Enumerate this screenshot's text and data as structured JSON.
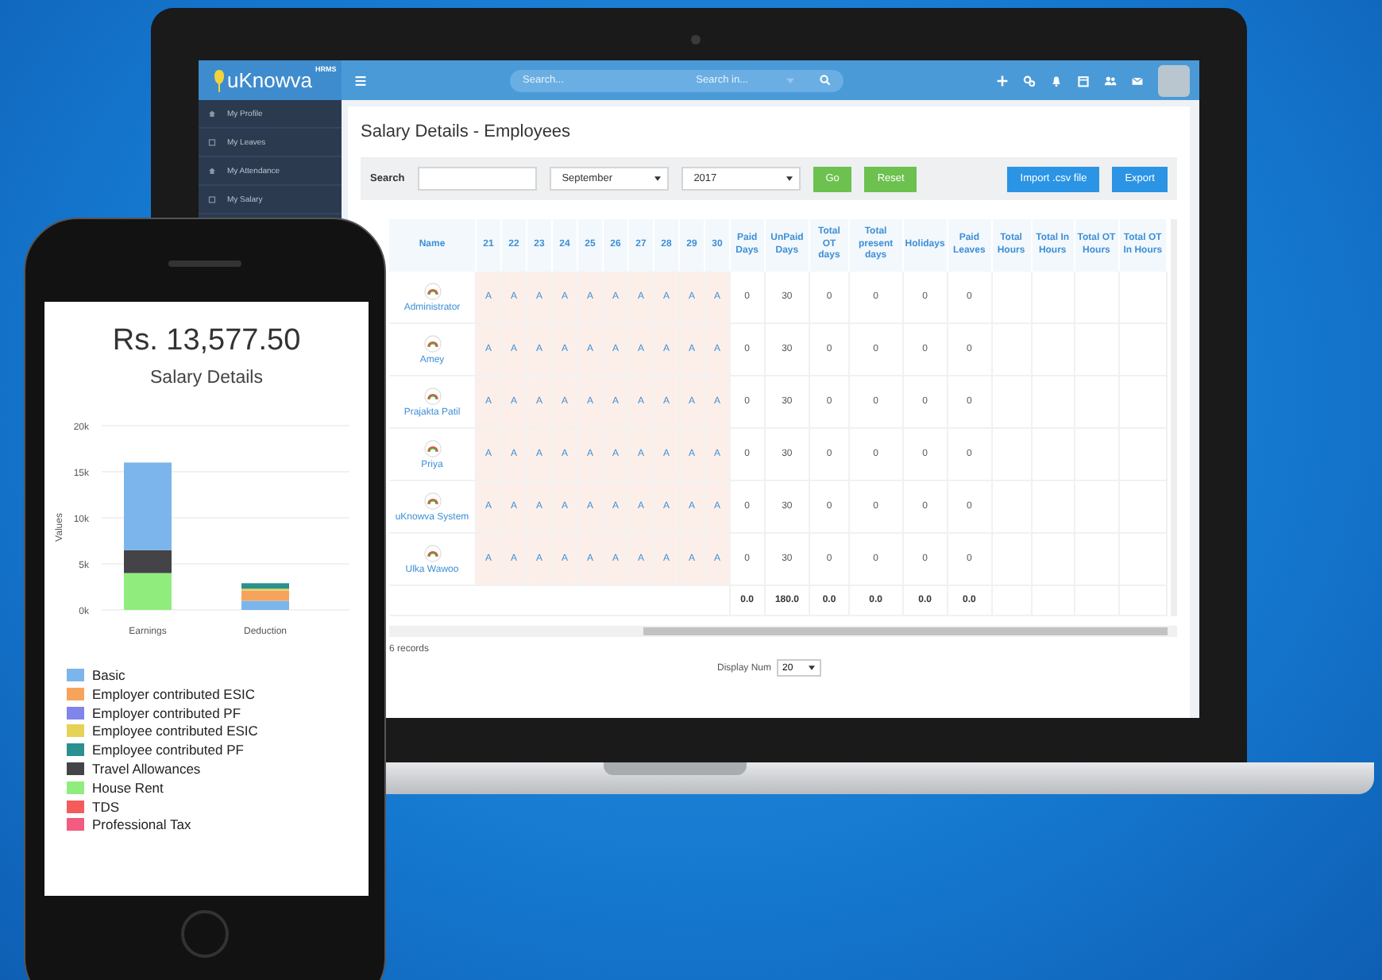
{
  "laptop": {
    "header": {
      "logo": {
        "name": "uKnowva",
        "badge": "HRMS"
      },
      "search": {
        "placeholder": "Search...",
        "scope": "Search in..."
      }
    },
    "sidebar": {
      "items": [
        {
          "label": "My Profile",
          "kind": "home"
        },
        {
          "label": "My Leaves",
          "kind": "calendar"
        },
        {
          "label": "My Attendance",
          "kind": "home"
        },
        {
          "label": "My Salary",
          "kind": "calendar"
        }
      ]
    },
    "page": {
      "title": "Salary Details - Employees",
      "filters": {
        "search_label": "Search",
        "month": "September",
        "year": "2017",
        "buttons": [
          {
            "label": "Go",
            "kind": "success"
          },
          {
            "label": "Reset",
            "kind": "success"
          },
          {
            "label": "Import .csv file",
            "kind": "info"
          },
          {
            "label": "Export",
            "kind": "info"
          }
        ]
      },
      "table": {
        "columns": [
          "Name",
          "21",
          "22",
          "23",
          "24",
          "25",
          "26",
          "27",
          "28",
          "29",
          "30",
          "Paid Days",
          "UnPaid Days",
          "Total OT days",
          "Total present days",
          "Holidays",
          "Paid Leaves",
          "Total Hours",
          "Total In Hours",
          "Total OT Hours",
          "Total OT In Hours"
        ],
        "rows": [
          {
            "name": "Administrator",
            "days": [
              "A",
              "A",
              "A",
              "A",
              "A",
              "A",
              "A",
              "A",
              "A",
              "A"
            ],
            "values": [
              "0",
              "30",
              "0",
              "0",
              "0",
              "0"
            ]
          },
          {
            "name": "Amey",
            "days": [
              "A",
              "A",
              "A",
              "A",
              "A",
              "A",
              "A",
              "A",
              "A",
              "A"
            ],
            "values": [
              "0",
              "30",
              "0",
              "0",
              "0",
              "0"
            ]
          },
          {
            "name": "Prajakta Patil",
            "days": [
              "A",
              "A",
              "A",
              "A",
              "A",
              "A",
              "A",
              "A",
              "A",
              "A"
            ],
            "values": [
              "0",
              "30",
              "0",
              "0",
              "0",
              "0"
            ]
          },
          {
            "name": "Priya",
            "days": [
              "A",
              "A",
              "A",
              "A",
              "A",
              "A",
              "A",
              "A",
              "A",
              "A"
            ],
            "values": [
              "0",
              "30",
              "0",
              "0",
              "0",
              "0"
            ]
          },
          {
            "name": "uKnowva System",
            "days": [
              "A",
              "A",
              "A",
              "A",
              "A",
              "A",
              "A",
              "A",
              "A",
              "A"
            ],
            "values": [
              "0",
              "30",
              "0",
              "0",
              "0",
              "0"
            ]
          },
          {
            "name": "Ulka Wawoo",
            "days": [
              "A",
              "A",
              "A",
              "A",
              "A",
              "A",
              "A",
              "A",
              "A",
              "A"
            ],
            "values": [
              "0",
              "30",
              "0",
              "0",
              "0",
              "0"
            ]
          }
        ],
        "totals": [
          "0.0",
          "180.0",
          "0.0",
          "0.0",
          "0.0",
          "0.0"
        ]
      },
      "records": "6 records",
      "pager": {
        "label": "Display Num",
        "value": "20"
      }
    }
  },
  "phone": {
    "amount": "Rs. 13,577.50",
    "title": "Salary Details",
    "chart_data": {
      "type": "bar",
      "stacked": true,
      "grid": true,
      "ylabel": "Values",
      "categories": [
        "Earnings",
        "Deduction"
      ],
      "ylim": [
        0,
        20000
      ],
      "yticks": [
        {
          "value": 0,
          "label": "0k"
        },
        {
          "value": 5000,
          "label": "5k"
        },
        {
          "value": 10000,
          "label": "10k"
        },
        {
          "value": 15000,
          "label": "15k"
        },
        {
          "value": 20000,
          "label": "20k"
        }
      ],
      "series": [
        {
          "name": "Basic",
          "color": "#7cb5ec",
          "values": [
            9500,
            1000
          ]
        },
        {
          "name": "Employer contributed ESIC",
          "color": "#f7a35c",
          "values": [
            0,
            1100
          ]
        },
        {
          "name": "Employer contributed PF",
          "color": "#8085e9",
          "values": [
            0,
            0
          ]
        },
        {
          "name": "Employee contributed ESIC",
          "color": "#e4d354",
          "values": [
            0,
            200
          ]
        },
        {
          "name": "Employee contributed PF",
          "color": "#2b908f",
          "values": [
            0,
            600
          ]
        },
        {
          "name": "Travel Allowances",
          "color": "#434348",
          "values": [
            2500,
            0
          ]
        },
        {
          "name": "House Rent",
          "color": "#90ed7d",
          "values": [
            4000,
            0
          ]
        },
        {
          "name": "TDS",
          "color": "#f45b5b",
          "values": [
            0,
            0
          ]
        },
        {
          "name": "Professional Tax",
          "color": "#f15c80",
          "values": [
            0,
            0
          ]
        }
      ]
    }
  }
}
